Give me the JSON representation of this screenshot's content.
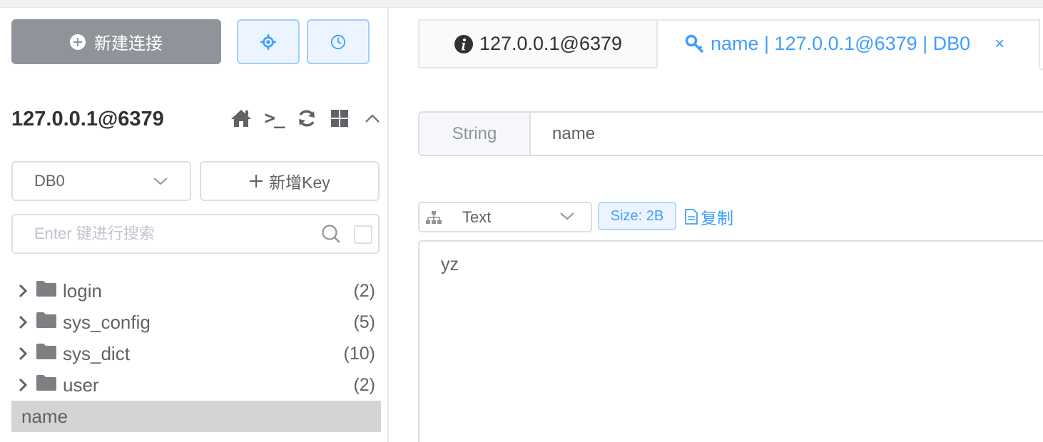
{
  "sidebar": {
    "new_connection_label": "新建连接",
    "connection_name": "127.0.0.1@6379",
    "db_selected": "DB0",
    "new_key_label": "新增Key",
    "search_placeholder": "Enter 键进行搜索",
    "tree": [
      {
        "name": "login",
        "count": "(2)"
      },
      {
        "name": "sys_config",
        "count": "(5)"
      },
      {
        "name": "sys_dict",
        "count": "(10)"
      },
      {
        "name": "user",
        "count": "(2)"
      }
    ],
    "selected_key": "name"
  },
  "tabs": [
    {
      "label": "127.0.0.1@6379",
      "icon": "info-icon"
    },
    {
      "label": "name | 127.0.0.1@6379 | DB0",
      "icon": "key-icon",
      "close": "×"
    }
  ],
  "key_detail": {
    "type": "String",
    "name": "name",
    "format": "Text",
    "size": "Size: 2B",
    "copy_label": "复制",
    "value": "yz"
  },
  "colors": {
    "accent": "#409eff",
    "sidebar_button": "#909399",
    "selected_row": "#d4d4d5"
  }
}
